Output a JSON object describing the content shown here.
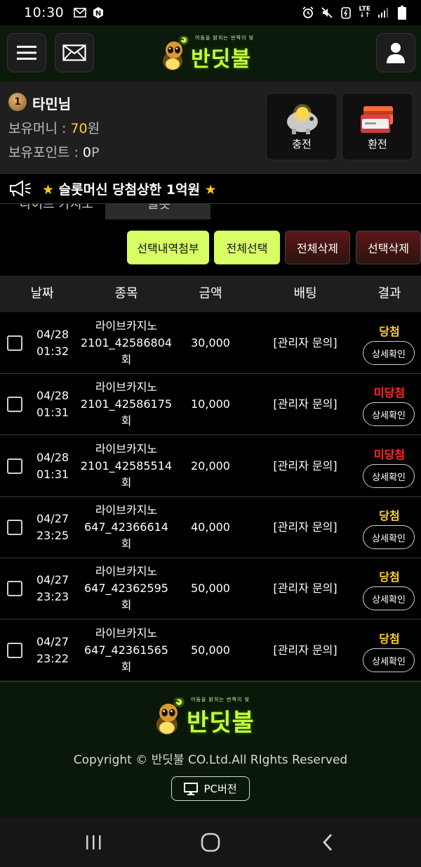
{
  "status_bar": {
    "time": "10:30",
    "network": "LTE"
  },
  "header": {
    "logo_tagline": "어둠을 밝히는 반짝이 빛",
    "logo_text": "반딧불",
    "menu_icon": "hamburger-menu-icon",
    "mail_icon": "envelope-icon",
    "user_icon": "user-icon"
  },
  "user": {
    "rank": "1",
    "name": "타민님",
    "money_label": "보유머니 : ",
    "money_value": "70",
    "money_unit": "원",
    "points_label": "보유포인트 : ",
    "points_value": "0",
    "points_unit": "P",
    "charge_label": "충전",
    "exchange_label": "환전"
  },
  "notice": {
    "star": "★",
    "text": "슬롯머신 당첨상한 1억원",
    "tab_left": "라이브 카지노",
    "tab_right": "슬롯"
  },
  "actions": {
    "attach_selected": "선택내역첨부",
    "select_all": "전체선택",
    "delete_all": "전체삭제",
    "delete_selected": "선택삭제"
  },
  "table": {
    "headers": [
      "날짜",
      "종목",
      "금액",
      "배팅",
      "결과"
    ],
    "rows": [
      {
        "date": "04/28",
        "time": "01:32",
        "game": "라이브카지노",
        "round": "2101_42586804",
        "round_suffix": "회",
        "amount": "30,000",
        "bet": "[관리자 문의]",
        "result": "당첨",
        "result_type": "win",
        "detail": "상세확인"
      },
      {
        "date": "04/28",
        "time": "01:31",
        "game": "라이브카지노",
        "round": "2101_42586175",
        "round_suffix": "회",
        "amount": "10,000",
        "bet": "[관리자 문의]",
        "result": "미당첨",
        "result_type": "lose",
        "detail": "상세확인"
      },
      {
        "date": "04/28",
        "time": "01:31",
        "game": "라이브카지노",
        "round": "2101_42585514",
        "round_suffix": "회",
        "amount": "20,000",
        "bet": "[관리자 문의]",
        "result": "미당첨",
        "result_type": "lose",
        "detail": "상세확인"
      },
      {
        "date": "04/27",
        "time": "23:25",
        "game": "라이브카지노",
        "round": "647_42366614",
        "round_suffix": "회",
        "amount": "40,000",
        "bet": "[관리자 문의]",
        "result": "당첨",
        "result_type": "win",
        "detail": "상세확인"
      },
      {
        "date": "04/27",
        "time": "23:23",
        "game": "라이브카지노",
        "round": "647_42362595",
        "round_suffix": "회",
        "amount": "50,000",
        "bet": "[관리자 문의]",
        "result": "당첨",
        "result_type": "win",
        "detail": "상세확인"
      },
      {
        "date": "04/27",
        "time": "23:22",
        "game": "라이브카지노",
        "round": "647_42361565",
        "round_suffix": "회",
        "amount": "50,000",
        "bet": "[관리자 문의]",
        "result": "당첨",
        "result_type": "win",
        "detail": "상세확인"
      }
    ]
  },
  "footer": {
    "copyright": "Copyright © 반딧불 CO.Ltd.All RIghts Reserved",
    "pc_version": "PC버전"
  },
  "colors": {
    "accent_green": "#d8ff63",
    "win": "#ffd028",
    "lose": "#ff2a2a"
  }
}
